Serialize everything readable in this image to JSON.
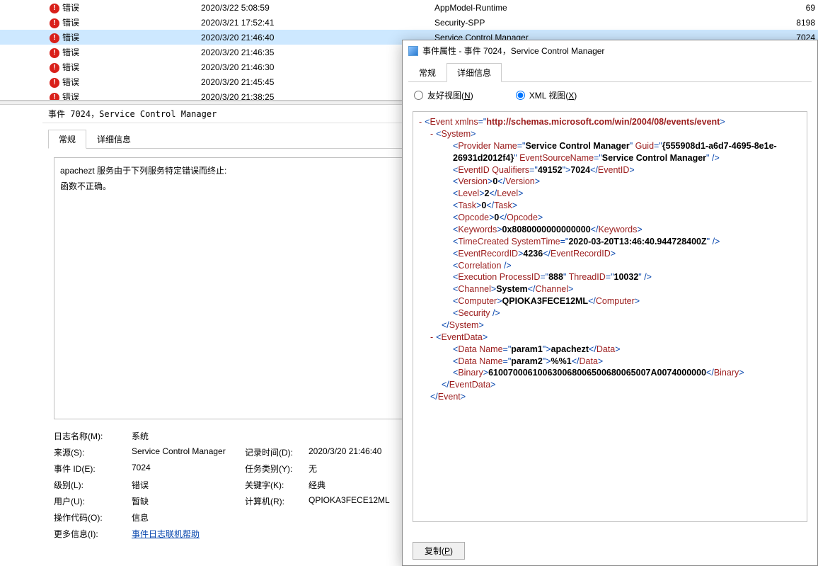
{
  "bottom_title": "事件 7024，Service Control Manager",
  "events": [
    {
      "level": "错误",
      "date": "2020/3/22 5:08:59",
      "source": "AppModel-Runtime",
      "id": "69"
    },
    {
      "level": "错误",
      "date": "2020/3/21 17:52:41",
      "source": "Security-SPP",
      "id": "8198"
    },
    {
      "level": "错误",
      "date": "2020/3/20 21:46:40",
      "source": "Service Control Manager",
      "id": "7024",
      "selected": true
    },
    {
      "level": "错误",
      "date": "2020/3/20 21:46:35",
      "source": "",
      "id": ""
    },
    {
      "level": "错误",
      "date": "2020/3/20 21:46:30",
      "source": "",
      "id": ""
    },
    {
      "level": "错误",
      "date": "2020/3/20 21:45:45",
      "source": "",
      "id": ""
    },
    {
      "level": "错误",
      "date": "2020/3/20 21:38:25",
      "source": "",
      "id": ""
    }
  ],
  "tabs": {
    "general": "常规",
    "details": "详细信息"
  },
  "detail_lines": [
    "apachezt 服务由于下列服务特定错误而终止:",
    "函数不正确。"
  ],
  "meta": {
    "log_name_label": "日志名称(M):",
    "log_name": "系统",
    "source_label": "来源(S):",
    "source": "Service Control Manager",
    "logged_label": "记录时间(D):",
    "logged": "2020/3/20 21:46:40",
    "eventid_label": "事件 ID(E):",
    "eventid": "7024",
    "task_label": "任务类别(Y):",
    "task": "无",
    "level_label": "级别(L):",
    "level": "错误",
    "keywords_label": "关键字(K):",
    "keywords": "经典",
    "user_label": "用户(U):",
    "user": "暂缺",
    "computer_label": "计算机(R):",
    "computer": "QPIOKA3FECE12ML",
    "opcode_label": "操作代码(O):",
    "opcode": "信息",
    "more_label": "更多信息(I):",
    "more_link": "事件日志联机帮助"
  },
  "dialog": {
    "title": "事件属性 - 事件 7024，Service Control Manager",
    "radio_friendly": "友好视图",
    "radio_friendly_key": "N",
    "radio_xml": "XML 视图",
    "radio_xml_key": "X",
    "copy_btn": "复制",
    "copy_key": "P"
  },
  "xml": {
    "xmlns": "http://schemas.microsoft.com/win/2004/08/events/event",
    "provider_name": "Service Control Manager",
    "provider_guid": "{555908d1-a6d7-4695-8e1e-26931d2012f4}",
    "event_source_name": "Service Control Manager",
    "eventid_qualifiers": "49152",
    "eventid": "7024",
    "version": "0",
    "level": "2",
    "task": "0",
    "opcode": "0",
    "keywords": "0x8080000000000000",
    "time_created": "2020-03-20T13:46:40.944728400Z",
    "event_record_id": "4236",
    "exec_pid": "888",
    "exec_tid": "10032",
    "channel": "System",
    "computer": "QPIOKA3FECE12ML",
    "param1_name": "param1",
    "param1_val": "apachezt",
    "param2_name": "param2",
    "param2_val": "%%1",
    "binary": "610070006100630068006500680065007A0074000000"
  }
}
